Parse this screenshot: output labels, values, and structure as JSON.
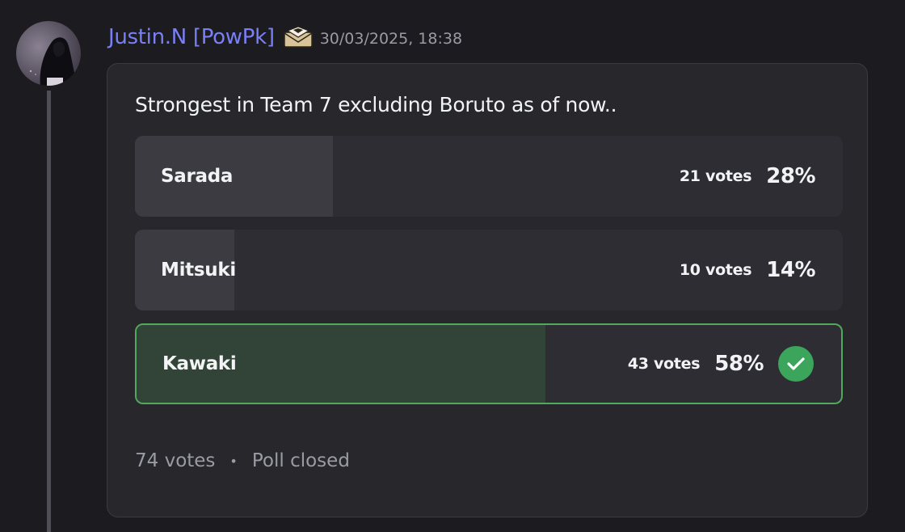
{
  "message": {
    "username": "Justin.N [PowPk]",
    "badge_icon": "envelope-badge-icon",
    "timestamp": "30/03/2025, 18:38"
  },
  "poll": {
    "question": "Strongest in Team 7 excluding Boruto as of now..",
    "answers": [
      {
        "label": "Sarada",
        "votes": "21 votes",
        "percent": "28%",
        "share": 0.28,
        "winner": false
      },
      {
        "label": "Mitsuki",
        "votes": "10 votes",
        "percent": "14%",
        "share": 0.14,
        "winner": false
      },
      {
        "label": "Kawaki",
        "votes": "43 votes",
        "percent": "58%",
        "share": 0.58,
        "winner": true
      }
    ],
    "total_votes": "74 votes",
    "separator": "•",
    "status": "Poll closed"
  },
  "colors": {
    "background": "#1c1c20",
    "card": "#27272c",
    "username": "#7b7ff5",
    "winner_border": "#52a85b",
    "winner_fill": "#324437",
    "check": "#3ba55c"
  }
}
